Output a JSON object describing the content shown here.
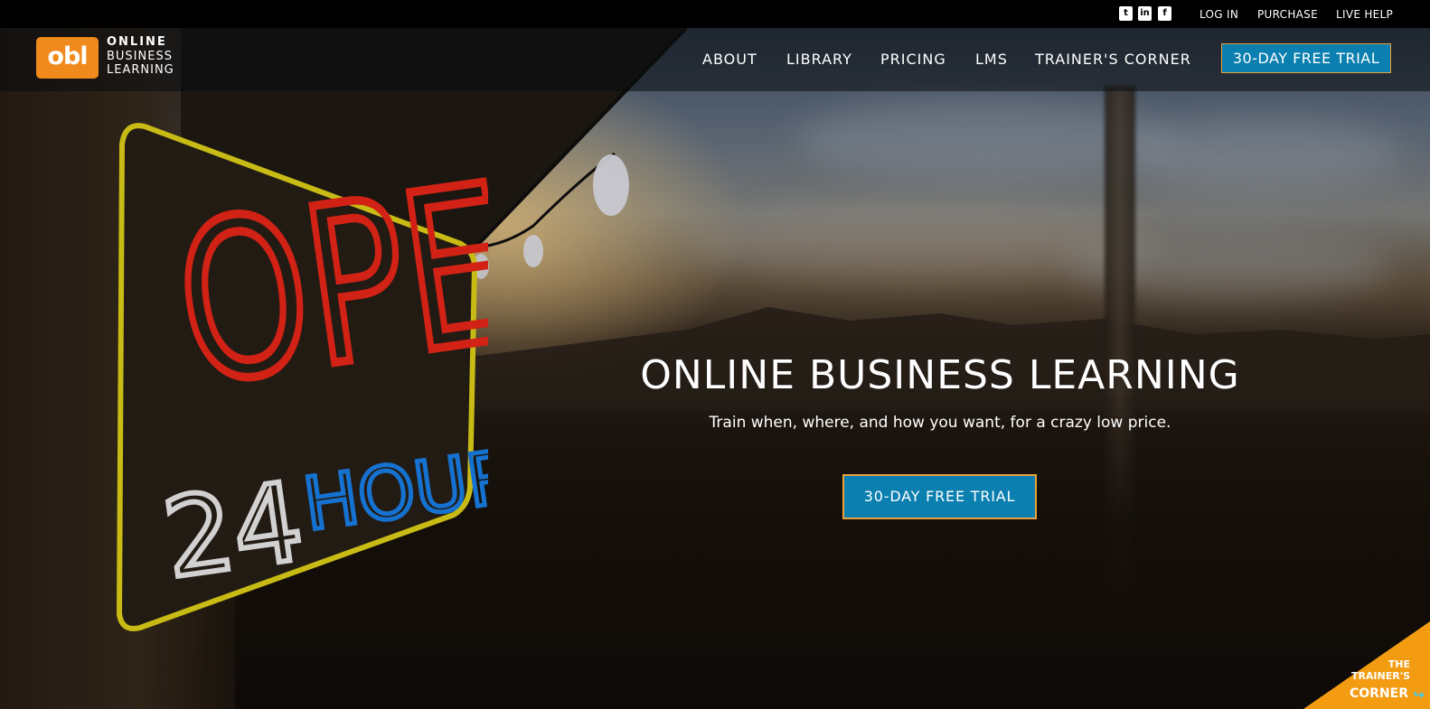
{
  "topbar": {
    "social": [
      {
        "name": "twitter-icon",
        "glyph": "t"
      },
      {
        "name": "linkedin-icon",
        "glyph": "in"
      },
      {
        "name": "facebook-icon",
        "glyph": "f"
      }
    ],
    "links": [
      "LOG IN",
      "PURCHASE",
      "LIVE HELP"
    ]
  },
  "brand": {
    "logo_text": "obl",
    "line1": "ONLINE",
    "line2": "BUSINESS",
    "line3": "LEARNING"
  },
  "nav": {
    "items": [
      "ABOUT",
      "LIBRARY",
      "PRICING",
      "LMS",
      "TRAINER'S CORNER"
    ],
    "trial_label": "30-DAY FREE TRIAL"
  },
  "hero": {
    "title": "ONLINE BUSINESS LEARNING",
    "subtitle": "Train when, where, and how you want, for a crazy low price.",
    "cta_label": "30-DAY FREE TRIAL"
  },
  "sign": {
    "line1": "OPEN",
    "line2_num": "24",
    "line2_word": "HOURS"
  },
  "corner_badge": {
    "line1": "THE",
    "line2": "TRAINER'S",
    "line3": "CORNER"
  },
  "colors": {
    "accent_blue": "#0a7fb0",
    "accent_orange": "#f08a1c",
    "button_border": "#e9a23b",
    "neon_red": "#ff2a1a",
    "neon_blue": "#1a8cff",
    "neon_yellow": "#f4e41a"
  }
}
